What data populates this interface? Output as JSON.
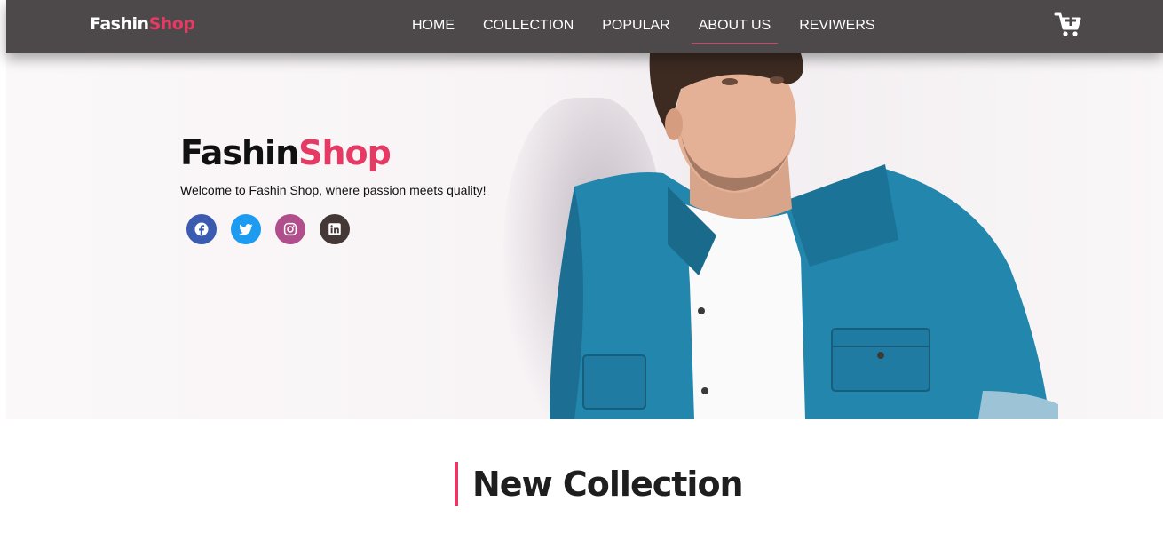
{
  "brand": {
    "name_part1": "Fashin",
    "name_part2": "Shop"
  },
  "nav": {
    "items": [
      {
        "label": "HOME",
        "active": false
      },
      {
        "label": "COLLECTION",
        "active": false
      },
      {
        "label": "POPULAR",
        "active": false
      },
      {
        "label": "ABOUT US",
        "active": true
      },
      {
        "label": "REVIWERS",
        "active": false
      }
    ],
    "cart_icon": "cart-plus-icon"
  },
  "hero": {
    "title_part1": "Fashin",
    "title_part2": "Shop",
    "subtitle": "Welcome to Fashin Shop, where passion meets quality!",
    "socials": [
      {
        "icon": "facebook-icon",
        "color": "#3b5bb0"
      },
      {
        "icon": "twitter-icon",
        "color": "#1d9bf0"
      },
      {
        "icon": "instagram-icon",
        "color": "#b14f8c"
      },
      {
        "icon": "linkedin-icon",
        "color": "#433836"
      }
    ]
  },
  "section": {
    "title": "New Collection"
  },
  "colors": {
    "navbar": "#4d494a",
    "accent": "#e43a63",
    "denim": "#1f7fa8"
  }
}
